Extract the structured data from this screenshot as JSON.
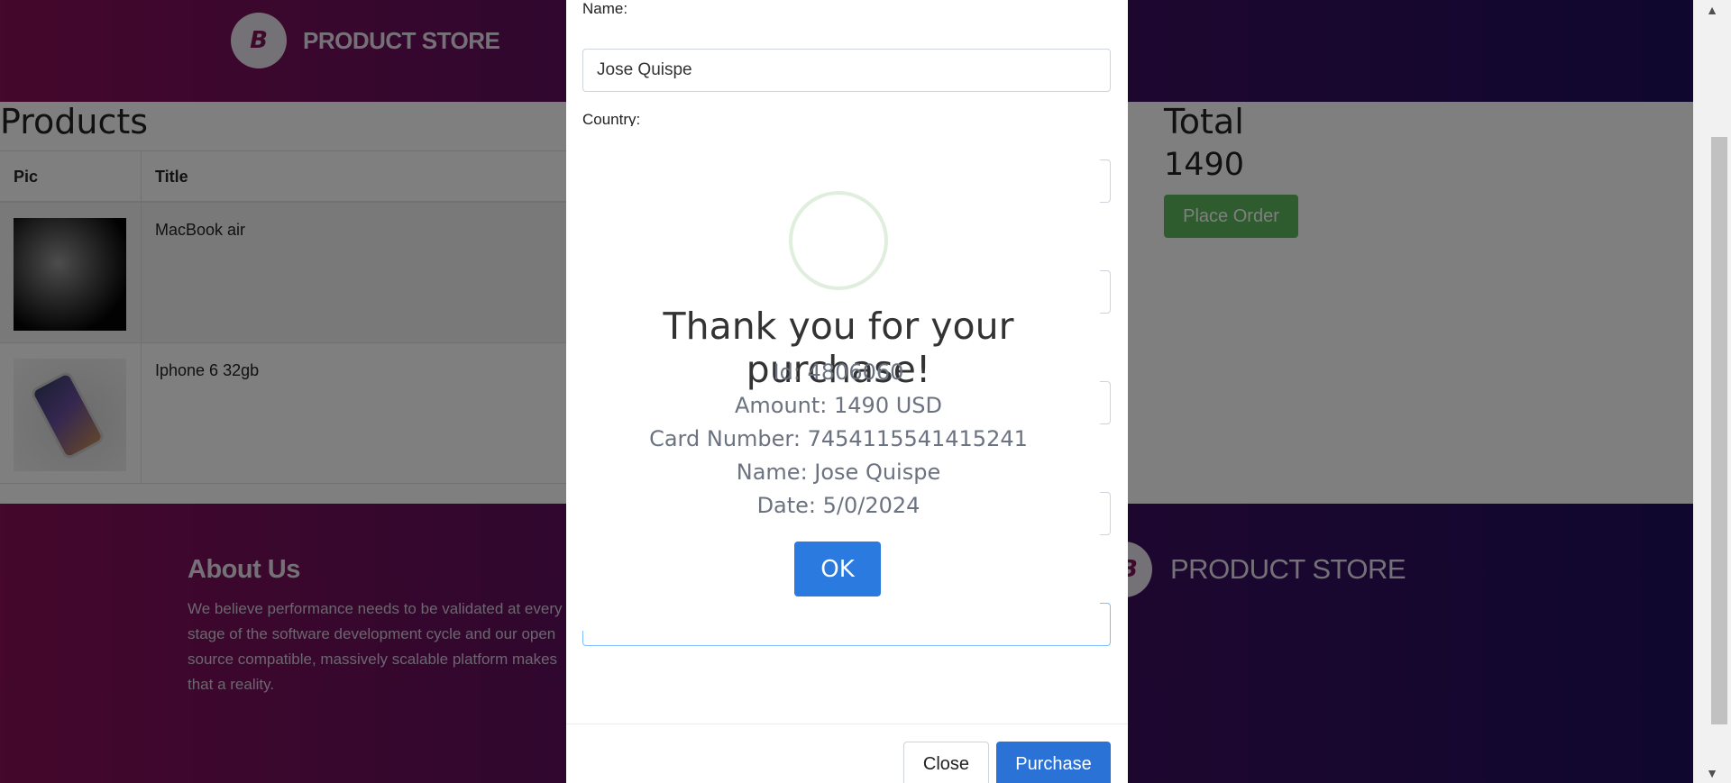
{
  "navbar": {
    "brand_logo_letter": "B",
    "brand_text": "PRODUCT STORE"
  },
  "products": {
    "title": "Products",
    "columns": [
      "Pic",
      "Title"
    ],
    "rows": [
      {
        "title": "MacBook air",
        "image": "macbook-air-image"
      },
      {
        "title": "Iphone 6 32gb",
        "image": "iphone-image"
      }
    ]
  },
  "total": {
    "title": "Total",
    "value": "1490",
    "place_order_label": "Place Order"
  },
  "footer": {
    "about_title": "About Us",
    "about_text": "We believe performance needs to be validated at every stage of the software development cycle and our open source compatible, massively scalable platform makes that a reality.",
    "brand_text": "PRODUCT STORE"
  },
  "modal": {
    "name_label": "Name:",
    "name_value": "Jose Quispe",
    "country_label": "Country:",
    "year_value": "2024",
    "close_label": "Close",
    "purchase_label": "Purchase"
  },
  "alert": {
    "icon": "success-check-icon",
    "title": "Thank you for your purchase!",
    "lines": {
      "id": "Id: 4806060",
      "amount": "Amount: 1490 USD",
      "card": "Card Number: 7454115541415241",
      "name": "Name: Jose Quispe",
      "date": "Date: 5/0/2024"
    },
    "ok_label": "OK"
  },
  "colors": {
    "accent_blue": "#2b72d6",
    "success_green": "#5cb85c",
    "brand_magenta": "#8a0f59",
    "brand_indigo": "#1f0f5e"
  }
}
